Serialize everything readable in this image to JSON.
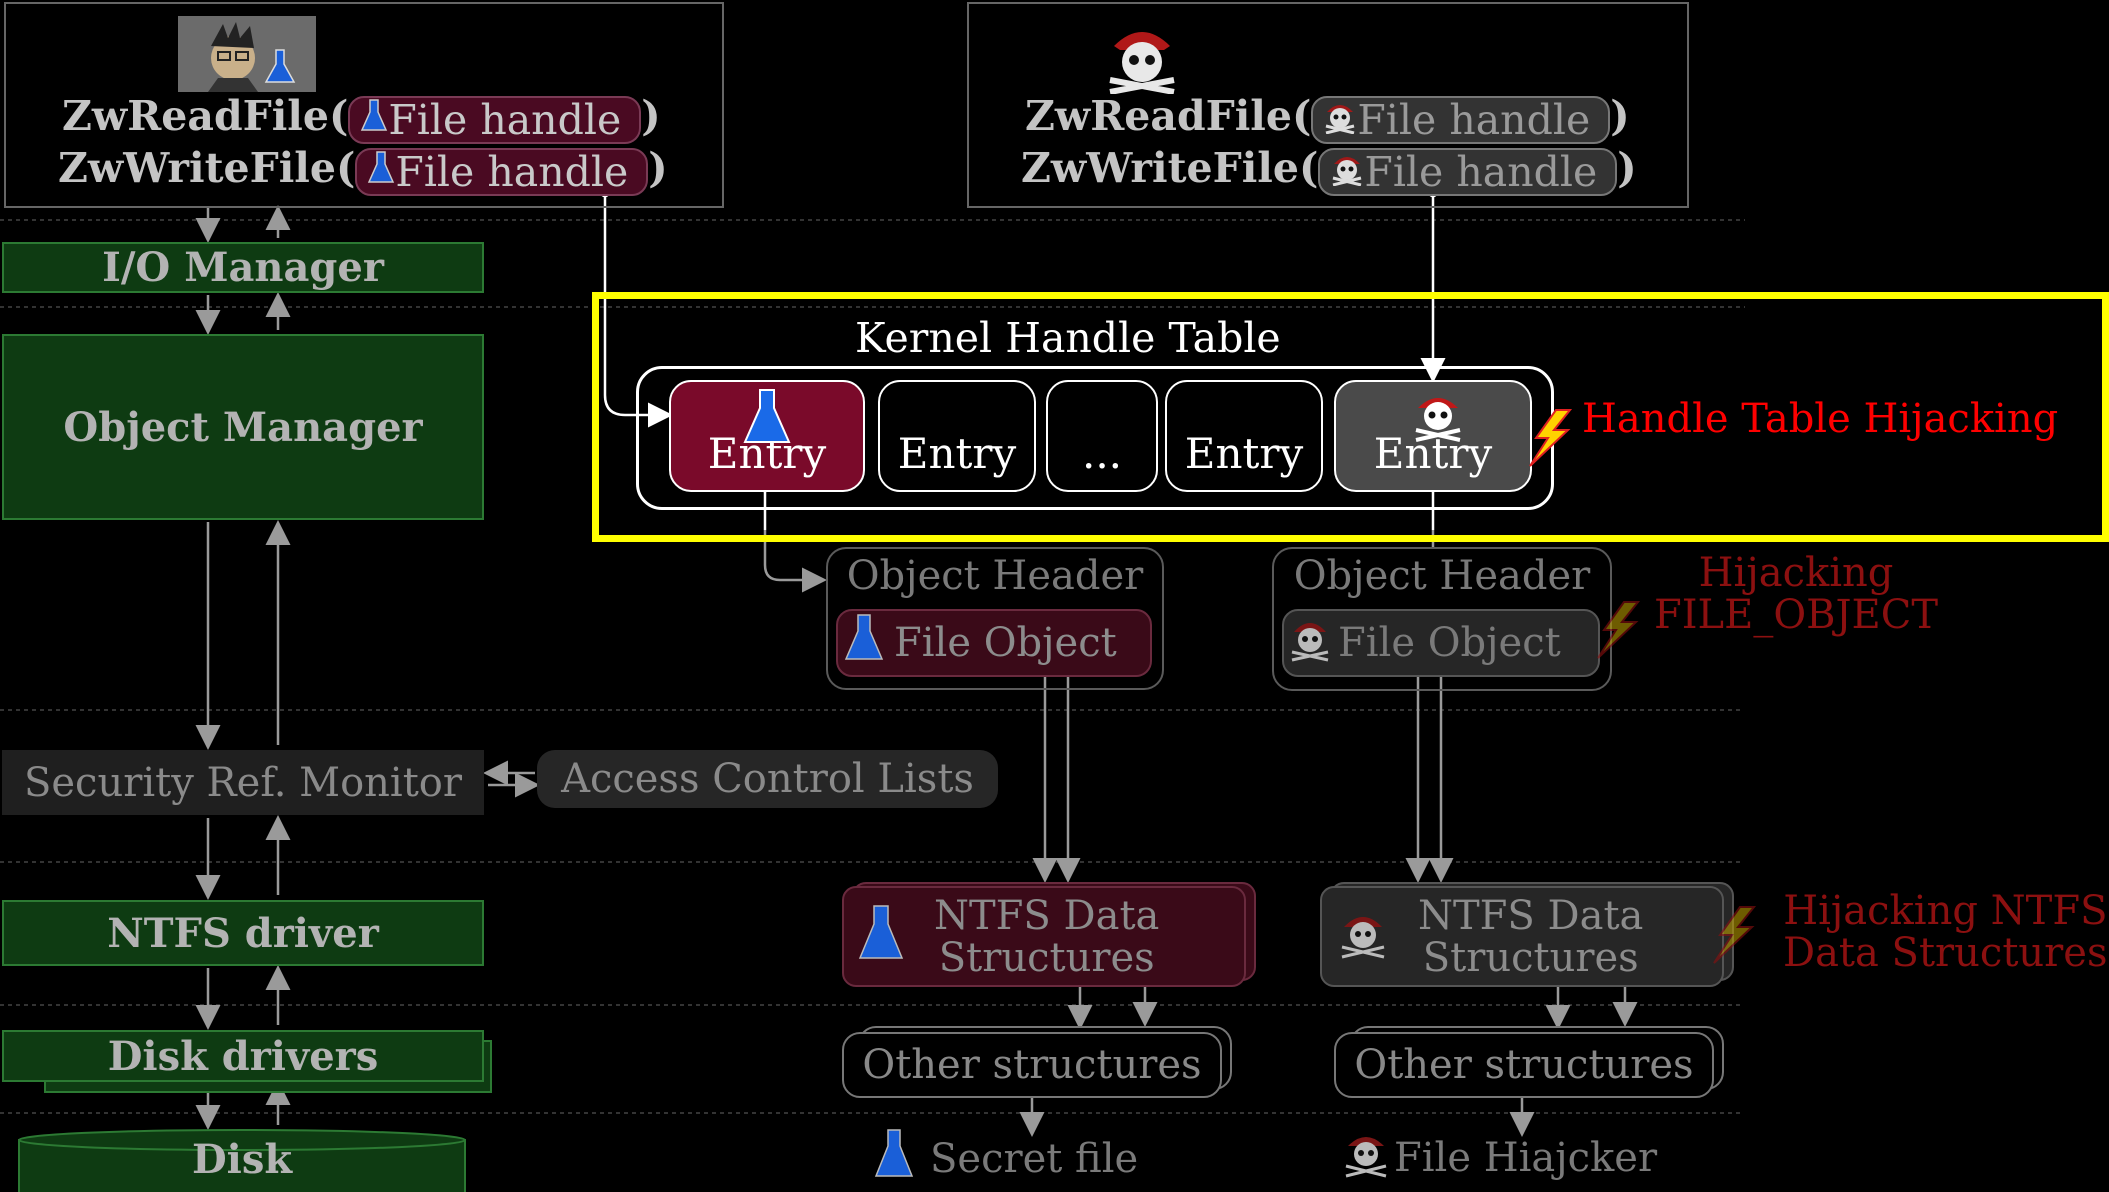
{
  "left_panel": {
    "call_read": "ZwReadFile(",
    "call_write": "ZwWriteFile(",
    "handle_label": "File handle",
    "close_paren": ")"
  },
  "right_panel": {
    "call_read": "ZwReadFile(",
    "call_write": "ZwWriteFile(",
    "handle_label": "File handle",
    "close_paren": ")"
  },
  "layers": {
    "io_manager": "I/O Manager",
    "object_manager": "Object Manager",
    "security_ref_monitor": "Security Ref. Monitor",
    "access_control_lists": "Access Control Lists",
    "ntfs_driver": "NTFS driver",
    "disk_drivers": "Disk drivers",
    "disk": "Disk"
  },
  "handle_table": {
    "title": "Kernel Handle Table",
    "entries": [
      "Entry",
      "Entry",
      "...",
      "Entry",
      "Entry"
    ]
  },
  "object_header": {
    "header_label": "Object Header",
    "file_object_label": "File Object"
  },
  "ntfs_structures": {
    "line1": "NTFS Data",
    "line2": "Structures"
  },
  "other_structures": "Other structures",
  "legend": {
    "secret_file": "Secret file",
    "file_hijacker": "File Hiajcker"
  },
  "attack_labels": {
    "handle_table": "Handle Table Hijacking",
    "file_object_line1": "Hijacking",
    "file_object_line2": "FILE_OBJECT",
    "ntfs_line1": "Hijacking NTFS",
    "ntfs_line2": "Data Structures"
  },
  "colors": {
    "highlight": "#ffff00",
    "legit_path": "#7a0a2a",
    "hijacker_path": "#4a4a4a",
    "layer_green": "#0e3b12",
    "attack_red": "#ff0000",
    "attack_dark_red": "#8c1010"
  },
  "icons": {
    "legit": "flask-icon",
    "attacker": "pirate-skull-icon",
    "attack": "lightning-icon",
    "user_avatar": "scientist-avatar-icon"
  }
}
